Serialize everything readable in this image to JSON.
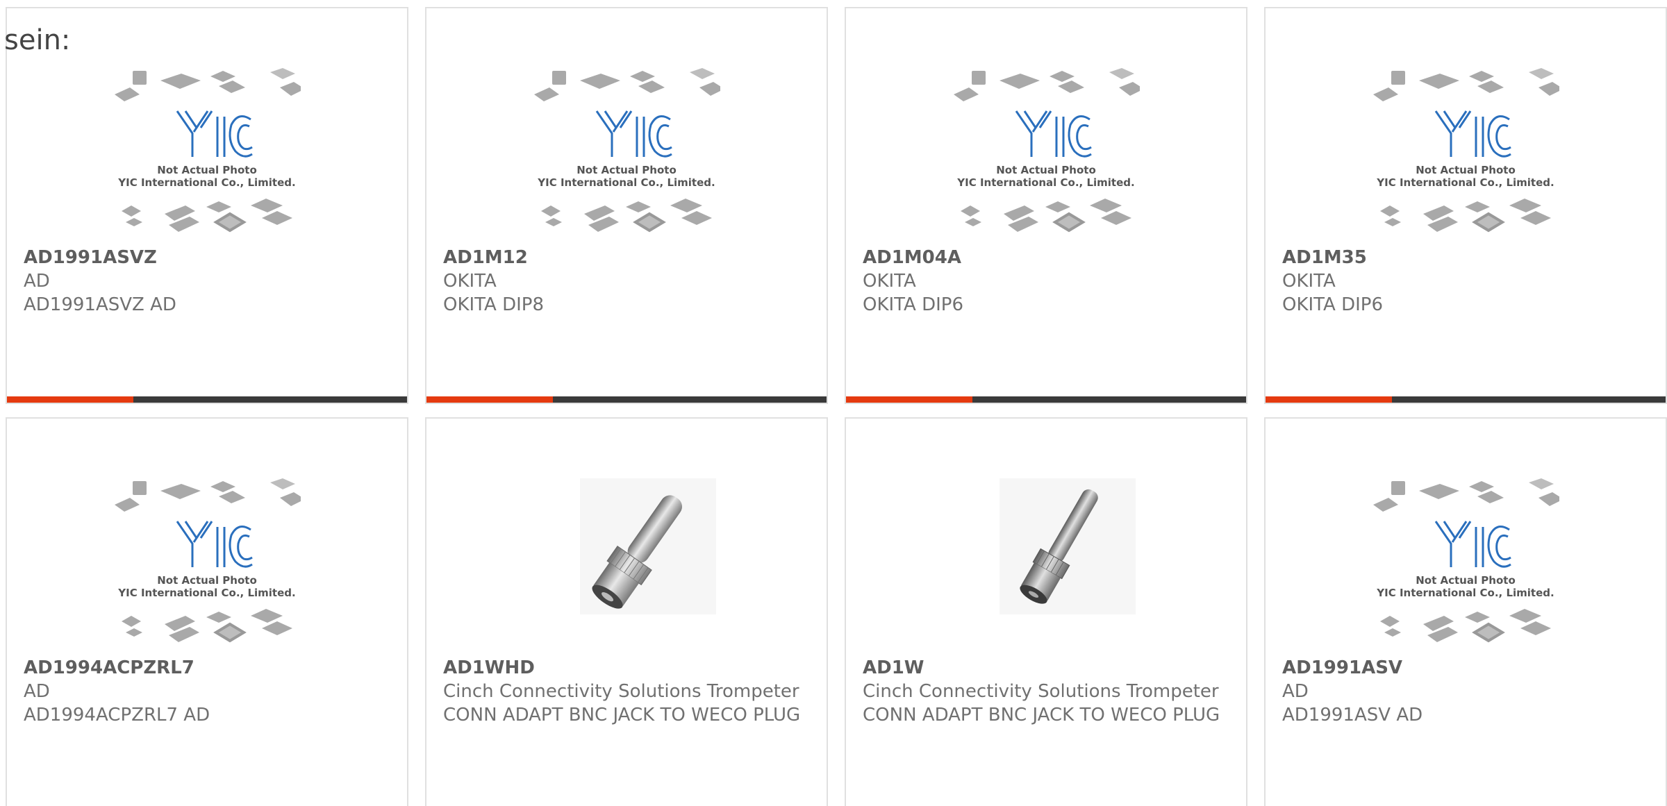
{
  "lead_text": "sein:",
  "placeholder_caption": {
    "line1": "Not Actual Photo",
    "line2": "YIC International Co., Limited.",
    "logo": "YIC"
  },
  "colors": {
    "accent": "#e53a10",
    "bar": "#3a3a3a",
    "logo_blue": "#1c6cc0"
  },
  "products": [
    {
      "part": "AD1991ASVZ",
      "brand": "AD",
      "desc": "AD1991ASVZ AD",
      "image": "placeholder"
    },
    {
      "part": "AD1M12",
      "brand": "OKITA",
      "desc": "OKITA DIP8",
      "image": "placeholder"
    },
    {
      "part": "AD1M04A",
      "brand": "OKITA",
      "desc": "OKITA DIP6",
      "image": "placeholder"
    },
    {
      "part": "AD1M35",
      "brand": "OKITA",
      "desc": "OKITA DIP6",
      "image": "placeholder"
    },
    {
      "part": "AD1994ACPZRL7",
      "brand": "AD",
      "desc": "AD1994ACPZRL7 AD",
      "image": "placeholder"
    },
    {
      "part": "AD1WHD",
      "brand": "Cinch Connectivity Solutions Trompeter",
      "desc": "CONN ADAPT BNC JACK TO WECO PLUG",
      "image": "bnc-adapter"
    },
    {
      "part": "AD1W",
      "brand": "Cinch Connectivity Solutions Trompeter",
      "desc": "CONN ADAPT BNC JACK TO WECO PLUG",
      "image": "bnc-adapter"
    },
    {
      "part": "AD1991ASV",
      "brand": "AD",
      "desc": "AD1991ASV AD",
      "image": "placeholder"
    }
  ]
}
